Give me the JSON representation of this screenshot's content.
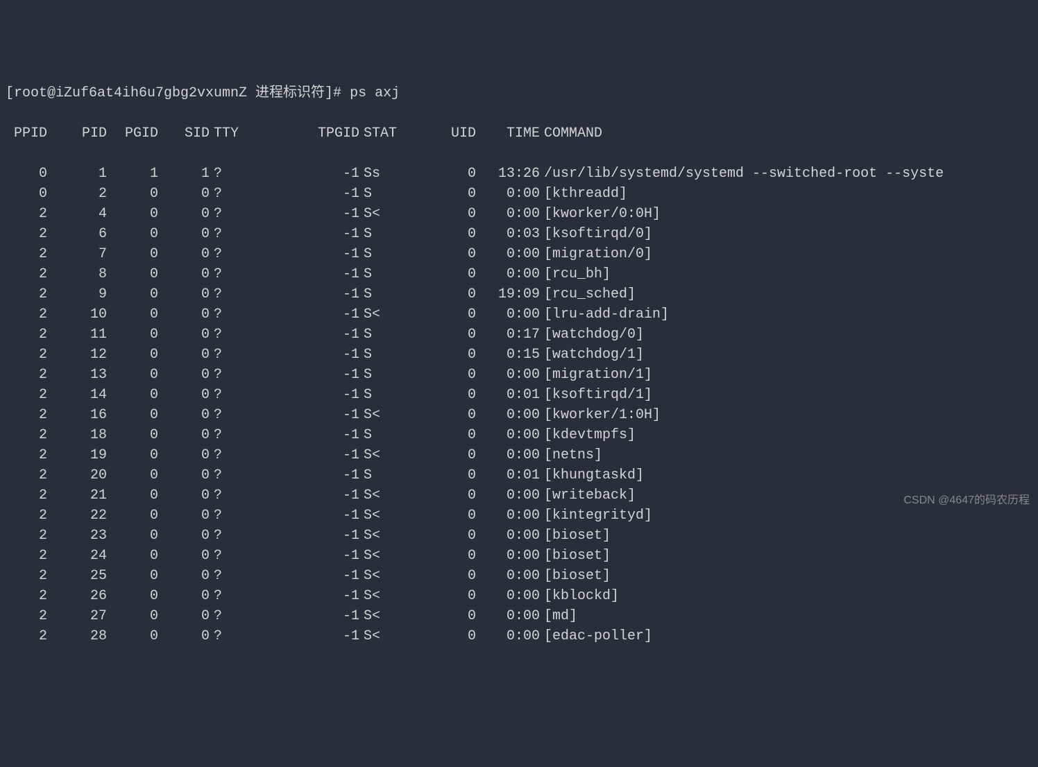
{
  "prompt": "[root@iZuf6at4ih6u7gbg2vxumnZ 进程标识符]# ps axj",
  "headers": {
    "ppid": "PPID",
    "pid": "PID",
    "pgid": "PGID",
    "sid": "SID",
    "tty": "TTY",
    "tpgid": "TPGID",
    "stat": "STAT",
    "uid": "UID",
    "time": "TIME",
    "command": "COMMAND"
  },
  "rows": [
    {
      "ppid": "0",
      "pid": "1",
      "pgid": "1",
      "sid": "1",
      "tty": "?",
      "tpgid": "-1",
      "stat": "Ss",
      "uid": "0",
      "time": "13:26",
      "cmd": "/usr/lib/systemd/systemd --switched-root --syste"
    },
    {
      "ppid": "0",
      "pid": "2",
      "pgid": "0",
      "sid": "0",
      "tty": "?",
      "tpgid": "-1",
      "stat": "S",
      "uid": "0",
      "time": "0:00",
      "cmd": "[kthreadd]"
    },
    {
      "ppid": "2",
      "pid": "4",
      "pgid": "0",
      "sid": "0",
      "tty": "?",
      "tpgid": "-1",
      "stat": "S<",
      "uid": "0",
      "time": "0:00",
      "cmd": "[kworker/0:0H]"
    },
    {
      "ppid": "2",
      "pid": "6",
      "pgid": "0",
      "sid": "0",
      "tty": "?",
      "tpgid": "-1",
      "stat": "S",
      "uid": "0",
      "time": "0:03",
      "cmd": "[ksoftirqd/0]"
    },
    {
      "ppid": "2",
      "pid": "7",
      "pgid": "0",
      "sid": "0",
      "tty": "?",
      "tpgid": "-1",
      "stat": "S",
      "uid": "0",
      "time": "0:00",
      "cmd": "[migration/0]"
    },
    {
      "ppid": "2",
      "pid": "8",
      "pgid": "0",
      "sid": "0",
      "tty": "?",
      "tpgid": "-1",
      "stat": "S",
      "uid": "0",
      "time": "0:00",
      "cmd": "[rcu_bh]"
    },
    {
      "ppid": "2",
      "pid": "9",
      "pgid": "0",
      "sid": "0",
      "tty": "?",
      "tpgid": "-1",
      "stat": "S",
      "uid": "0",
      "time": "19:09",
      "cmd": "[rcu_sched]"
    },
    {
      "ppid": "2",
      "pid": "10",
      "pgid": "0",
      "sid": "0",
      "tty": "?",
      "tpgid": "-1",
      "stat": "S<",
      "uid": "0",
      "time": "0:00",
      "cmd": "[lru-add-drain]"
    },
    {
      "ppid": "2",
      "pid": "11",
      "pgid": "0",
      "sid": "0",
      "tty": "?",
      "tpgid": "-1",
      "stat": "S",
      "uid": "0",
      "time": "0:17",
      "cmd": "[watchdog/0]"
    },
    {
      "ppid": "2",
      "pid": "12",
      "pgid": "0",
      "sid": "0",
      "tty": "?",
      "tpgid": "-1",
      "stat": "S",
      "uid": "0",
      "time": "0:15",
      "cmd": "[watchdog/1]"
    },
    {
      "ppid": "2",
      "pid": "13",
      "pgid": "0",
      "sid": "0",
      "tty": "?",
      "tpgid": "-1",
      "stat": "S",
      "uid": "0",
      "time": "0:00",
      "cmd": "[migration/1]"
    },
    {
      "ppid": "2",
      "pid": "14",
      "pgid": "0",
      "sid": "0",
      "tty": "?",
      "tpgid": "-1",
      "stat": "S",
      "uid": "0",
      "time": "0:01",
      "cmd": "[ksoftirqd/1]"
    },
    {
      "ppid": "2",
      "pid": "16",
      "pgid": "0",
      "sid": "0",
      "tty": "?",
      "tpgid": "-1",
      "stat": "S<",
      "uid": "0",
      "time": "0:00",
      "cmd": "[kworker/1:0H]"
    },
    {
      "ppid": "2",
      "pid": "18",
      "pgid": "0",
      "sid": "0",
      "tty": "?",
      "tpgid": "-1",
      "stat": "S",
      "uid": "0",
      "time": "0:00",
      "cmd": "[kdevtmpfs]"
    },
    {
      "ppid": "2",
      "pid": "19",
      "pgid": "0",
      "sid": "0",
      "tty": "?",
      "tpgid": "-1",
      "stat": "S<",
      "uid": "0",
      "time": "0:00",
      "cmd": "[netns]"
    },
    {
      "ppid": "2",
      "pid": "20",
      "pgid": "0",
      "sid": "0",
      "tty": "?",
      "tpgid": "-1",
      "stat": "S",
      "uid": "0",
      "time": "0:01",
      "cmd": "[khungtaskd]"
    },
    {
      "ppid": "2",
      "pid": "21",
      "pgid": "0",
      "sid": "0",
      "tty": "?",
      "tpgid": "-1",
      "stat": "S<",
      "uid": "0",
      "time": "0:00",
      "cmd": "[writeback]"
    },
    {
      "ppid": "2",
      "pid": "22",
      "pgid": "0",
      "sid": "0",
      "tty": "?",
      "tpgid": "-1",
      "stat": "S<",
      "uid": "0",
      "time": "0:00",
      "cmd": "[kintegrityd]"
    },
    {
      "ppid": "2",
      "pid": "23",
      "pgid": "0",
      "sid": "0",
      "tty": "?",
      "tpgid": "-1",
      "stat": "S<",
      "uid": "0",
      "time": "0:00",
      "cmd": "[bioset]"
    },
    {
      "ppid": "2",
      "pid": "24",
      "pgid": "0",
      "sid": "0",
      "tty": "?",
      "tpgid": "-1",
      "stat": "S<",
      "uid": "0",
      "time": "0:00",
      "cmd": "[bioset]"
    },
    {
      "ppid": "2",
      "pid": "25",
      "pgid": "0",
      "sid": "0",
      "tty": "?",
      "tpgid": "-1",
      "stat": "S<",
      "uid": "0",
      "time": "0:00",
      "cmd": "[bioset]"
    },
    {
      "ppid": "2",
      "pid": "26",
      "pgid": "0",
      "sid": "0",
      "tty": "?",
      "tpgid": "-1",
      "stat": "S<",
      "uid": "0",
      "time": "0:00",
      "cmd": "[kblockd]"
    },
    {
      "ppid": "2",
      "pid": "27",
      "pgid": "0",
      "sid": "0",
      "tty": "?",
      "tpgid": "-1",
      "stat": "S<",
      "uid": "0",
      "time": "0:00",
      "cmd": "[md]"
    },
    {
      "ppid": "2",
      "pid": "28",
      "pgid": "0",
      "sid": "0",
      "tty": "?",
      "tpgid": "-1",
      "stat": "S<",
      "uid": "0",
      "time": "0:00",
      "cmd": "[edac-poller]"
    }
  ],
  "watermark": "CSDN @4647的码农历程"
}
